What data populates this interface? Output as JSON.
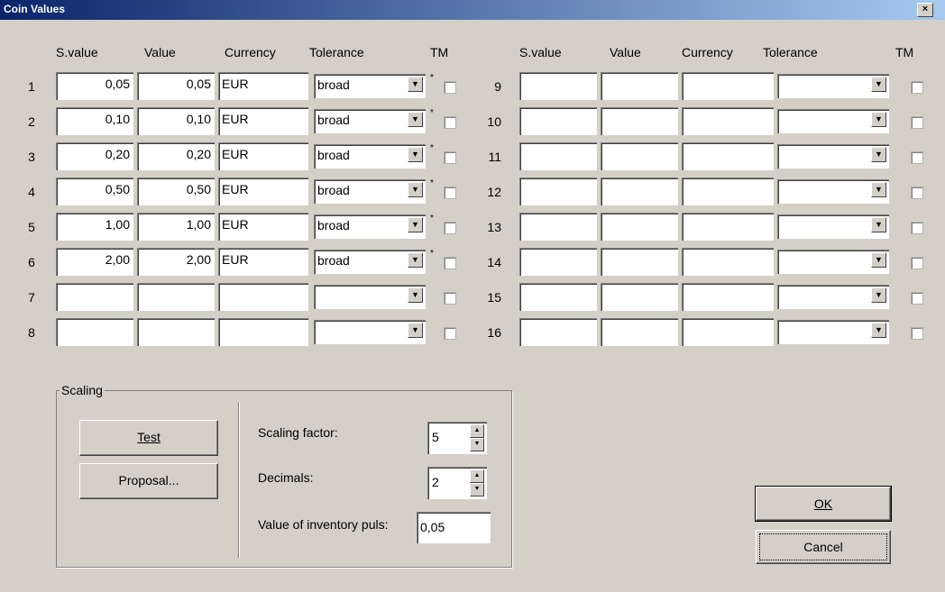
{
  "window": {
    "title": "Coin Values",
    "close": "×"
  },
  "headers": {
    "svalue": "S.value",
    "value": "Value",
    "currency": "Currency",
    "tolerance": "Tolerance",
    "tm": "TM"
  },
  "rows_left": [
    {
      "num": "1",
      "svalue": "0,05",
      "value": "0,05",
      "currency": "EUR",
      "tolerance": "broad",
      "star": "*"
    },
    {
      "num": "2",
      "svalue": "0,10",
      "value": "0,10",
      "currency": "EUR",
      "tolerance": "broad",
      "star": "*"
    },
    {
      "num": "3",
      "svalue": "0,20",
      "value": "0,20",
      "currency": "EUR",
      "tolerance": "broad",
      "star": "*"
    },
    {
      "num": "4",
      "svalue": "0,50",
      "value": "0,50",
      "currency": "EUR",
      "tolerance": "broad",
      "star": "*"
    },
    {
      "num": "5",
      "svalue": "1,00",
      "value": "1,00",
      "currency": "EUR",
      "tolerance": "broad",
      "star": "*"
    },
    {
      "num": "6",
      "svalue": "2,00",
      "value": "2,00",
      "currency": "EUR",
      "tolerance": "broad",
      "star": "*"
    },
    {
      "num": "7",
      "svalue": "",
      "value": "",
      "currency": "",
      "tolerance": "",
      "star": ""
    },
    {
      "num": "8",
      "svalue": "",
      "value": "",
      "currency": "",
      "tolerance": "",
      "star": ""
    }
  ],
  "rows_right": [
    {
      "num": "9"
    },
    {
      "num": "10"
    },
    {
      "num": "11"
    },
    {
      "num": "12"
    },
    {
      "num": "13"
    },
    {
      "num": "14"
    },
    {
      "num": "15"
    },
    {
      "num": "16"
    }
  ],
  "scaling": {
    "group_label": "Scaling",
    "test_button": "Test",
    "proposal_button": "Proposal...",
    "scaling_factor_label": "Scaling factor:",
    "scaling_factor_value": "5",
    "decimals_label": "Decimals:",
    "decimals_value": "2",
    "inventory_label": "Value of inventory puls:",
    "inventory_value": "0,05"
  },
  "buttons": {
    "ok": "OK",
    "cancel": "Cancel"
  },
  "icons": {
    "dropdown": "chevron-down-icon",
    "spin_up": "spin-up-icon",
    "spin_down": "spin-down-icon"
  }
}
